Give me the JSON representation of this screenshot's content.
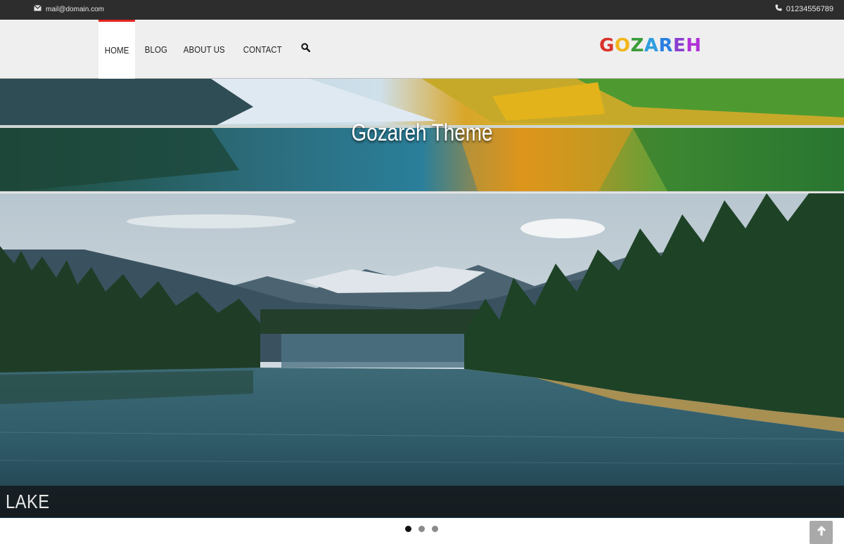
{
  "topbar": {
    "email": "mail@domain.com",
    "phone": "01234556789"
  },
  "nav": {
    "items": [
      {
        "label": "HOME",
        "active": true
      },
      {
        "label": "BLOG",
        "active": false
      },
      {
        "label": "ABOUT US",
        "active": false
      },
      {
        "label": "CONTACT",
        "active": false
      }
    ],
    "search_icon": "search-icon"
  },
  "logo": {
    "letters": [
      {
        "char": "G",
        "color": "#d9322a"
      },
      {
        "char": "O",
        "color": "#f2b51a"
      },
      {
        "char": "Z",
        "color": "#3a9d3a"
      },
      {
        "char": "A",
        "color": "#2e9ee0"
      },
      {
        "char": "R",
        "color": "#2a7fe0"
      },
      {
        "char": "E",
        "color": "#8a3fd0"
      },
      {
        "char": "H",
        "color": "#b030d8"
      }
    ]
  },
  "banner": {
    "title": "Gozareh Theme"
  },
  "slider": {
    "caption": "LAKE",
    "slide_count": 3,
    "active_slide": 1
  },
  "colors": {
    "accent": "#e5251f",
    "topbar_bg": "#2d2d2d",
    "header_bg": "#efefef"
  }
}
